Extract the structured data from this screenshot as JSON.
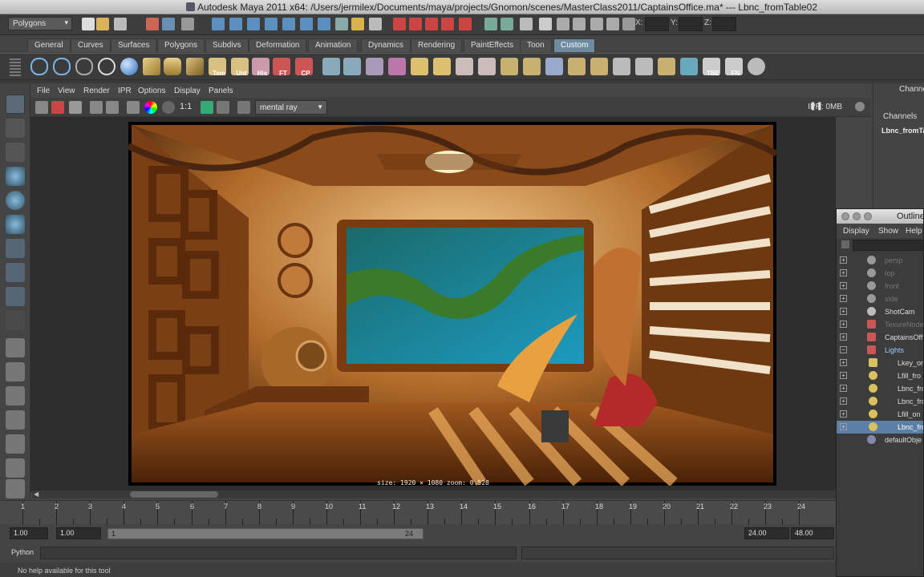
{
  "window": {
    "title": "Autodesk Maya 2011 x64: /Users/jermilex/Documents/maya/projects/Gnomon/scenes/MasterClass2011/CaptainsOffice.ma*   ---   Lbnc_fromTable02"
  },
  "status_line": {
    "menu_set": "Polygons",
    "x_label": "X:",
    "y_label": "Y:",
    "z_label": "Z:"
  },
  "shelf": {
    "tabs": [
      "General",
      "Curves",
      "Surfaces",
      "Polygons",
      "Subdivs",
      "Deformation",
      "Animation",
      "Dynamics",
      "Rendering",
      "PaintEffects",
      "Toon",
      "Custom"
    ],
    "active_tab": "Custom",
    "icon_labels": [
      "Tem",
      "Unt",
      "His",
      "FT",
      "CP",
      "TBE",
      "FN"
    ]
  },
  "render_view": {
    "menus": [
      "File",
      "View",
      "Render",
      "IPR",
      "Options",
      "Display",
      "Panels"
    ],
    "ratio_label": "1:1",
    "renderer": "mental ray",
    "ipr_status": "IPR: 0MB",
    "image_info": "size: 1920 × 1080  zoom: 0.528"
  },
  "channel_box": {
    "header": "Channel",
    "tab": "Channels",
    "object": "Lbnc_fromTa"
  },
  "outliner": {
    "title": "Outline",
    "menus": [
      "Display",
      "Show",
      "Help"
    ],
    "items": [
      {
        "label": "persp",
        "dim": true
      },
      {
        "label": "top",
        "dim": true
      },
      {
        "label": "front",
        "dim": true
      },
      {
        "label": "side",
        "dim": true
      },
      {
        "label": "ShotCam",
        "dim": false
      },
      {
        "label": "TexureNode",
        "dim": true
      },
      {
        "label": "CaptainsOff",
        "dim": false
      },
      {
        "label": "Lights",
        "dim": false
      },
      {
        "label": "Lkey_on",
        "dim": false
      },
      {
        "label": "Lfill_fro",
        "dim": false
      },
      {
        "label": "Lbnc_fro",
        "dim": false
      },
      {
        "label": "Lbnc_fro",
        "dim": false
      },
      {
        "label": "Lfill_on",
        "dim": false
      },
      {
        "label": "Lbnc_fro",
        "dim": false,
        "selected": true
      },
      {
        "label": "defaultObje",
        "dim": false
      }
    ]
  },
  "time_slider": {
    "ticks": [
      "1",
      "2",
      "3",
      "4",
      "5",
      "6",
      "7",
      "8",
      "9",
      "10",
      "11",
      "12",
      "13",
      "14",
      "15",
      "16",
      "17",
      "18",
      "19",
      "20",
      "21",
      "22",
      "23",
      "24"
    ]
  },
  "range_slider": {
    "start": "1.00",
    "playback_start": "1.00",
    "bar_start": "1",
    "bar_end": "24",
    "playback_end": "24.00",
    "end": "48.00"
  },
  "command_line": {
    "label": "Python"
  },
  "help_line": {
    "text": "No help available for this tool"
  }
}
